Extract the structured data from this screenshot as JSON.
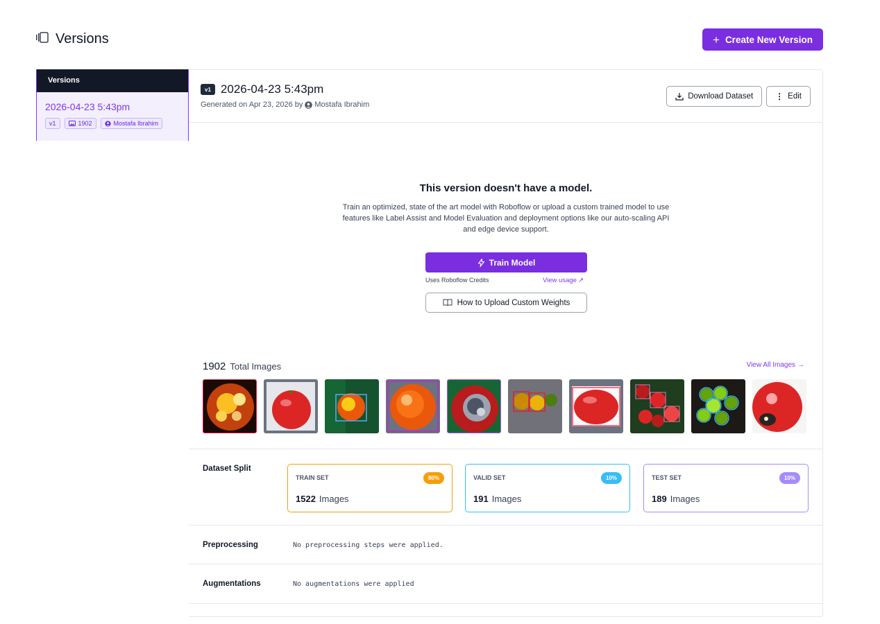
{
  "header": {
    "title": "Versions",
    "create_label": "Create New Version"
  },
  "sidebar": {
    "heading": "Versions",
    "items": [
      {
        "date": "2026-04-23 5:43pm",
        "version": "v1",
        "images": "1902",
        "user": "Mostafa Ibrahim"
      }
    ]
  },
  "version": {
    "badge": "v1",
    "title": "2026-04-23 5:43pm",
    "subtitle_prefix": "Generated on Apr 23, 2026 by",
    "author": "Mostafa Ibrahim",
    "download_label": "Download Dataset",
    "edit_label": "Edit"
  },
  "no_model": {
    "title": "This version doesn't have a model.",
    "description": "Train an optimized, state of the art model with Roboflow or upload a custom trained model to use features like Label Assist and Model Evaluation and deployment options like our auto-scaling API and edge device support.",
    "train_label": "Train Model",
    "credits_label": "Uses Roboflow Credits",
    "usage_label": "View usage",
    "upload_label": "How to Upload Custom Weights"
  },
  "images": {
    "total": "1902",
    "total_label": "Total Images",
    "view_all_label": "View All Images",
    "thumbnails": [
      "tomato-closeup-spots",
      "tomato-on-cloth",
      "tomato-on-plant",
      "orange-tomato",
      "rotten-tomato",
      "tomatoes-gray-bg",
      "red-tomato-white",
      "tomatoes-labeled",
      "green-tomatoes-labeled",
      "tomato-damaged"
    ]
  },
  "split": {
    "label": "Dataset Split",
    "sets": [
      {
        "name": "TRAIN SET",
        "percent": "80%",
        "count": "1522",
        "unit": "Images",
        "color": "#f59e0b"
      },
      {
        "name": "VALID SET",
        "percent": "10%",
        "count": "191",
        "unit": "Images",
        "color": "#38bdf8"
      },
      {
        "name": "TEST SET",
        "percent": "10%",
        "count": "189",
        "unit": "Images",
        "color": "#a78bfa"
      }
    ]
  },
  "preprocessing": {
    "label": "Preprocessing",
    "value": "No preprocessing steps were applied."
  },
  "augmentations": {
    "label": "Augmentations",
    "value": "No augmentations were applied"
  },
  "colors": {
    "accent": "#7a2ee0",
    "dark": "#121826"
  }
}
